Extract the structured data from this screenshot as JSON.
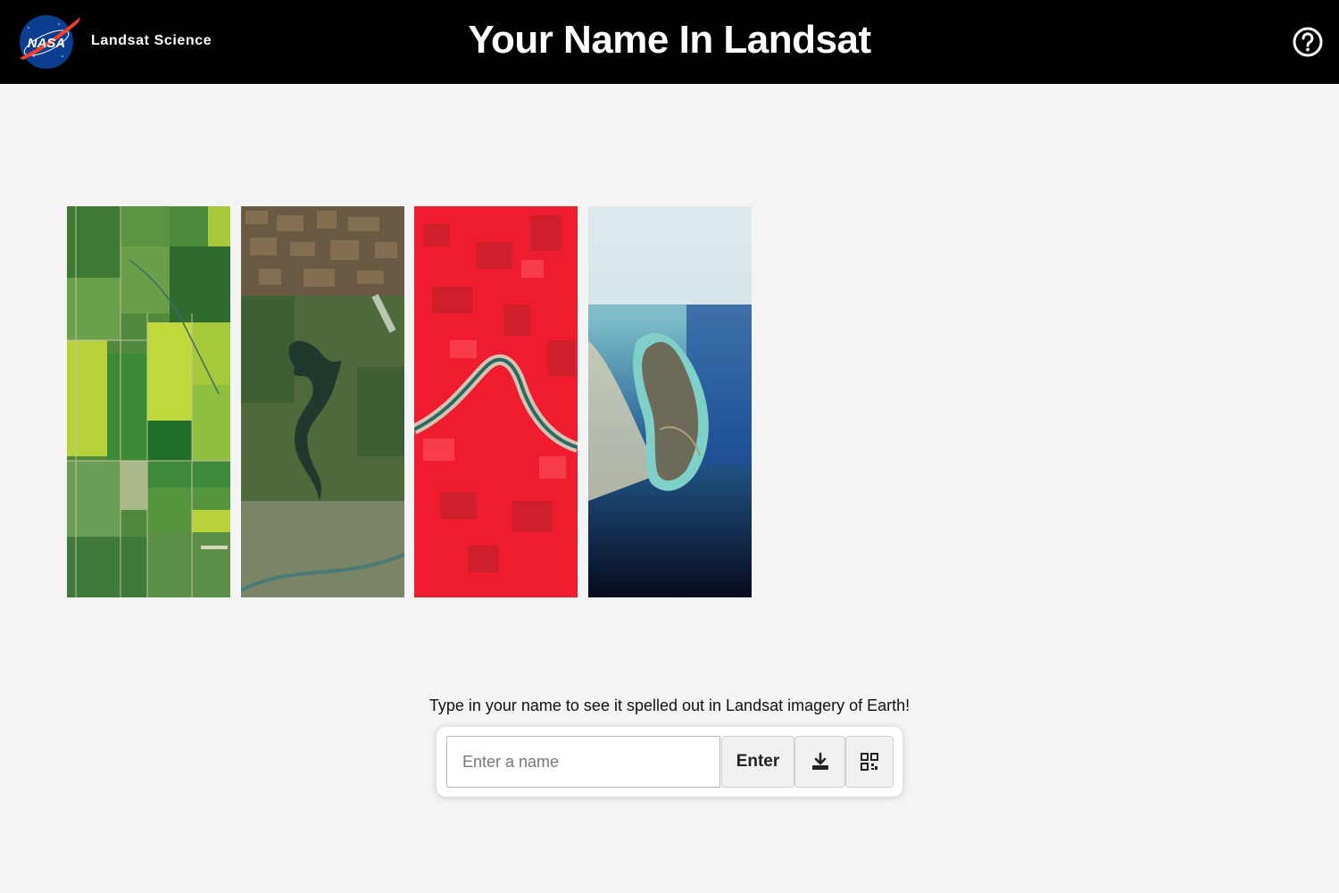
{
  "header": {
    "logo_text": "NASA",
    "brand": "Landsat Science",
    "title": "Your Name In Landsat",
    "help_icon": "question-circle-icon"
  },
  "tiles": [
    {
      "name": "letter-tile-1",
      "scene": "green-agricultural-fields"
    },
    {
      "name": "letter-tile-2",
      "scene": "oxbow-lake-farmland"
    },
    {
      "name": "letter-tile-3",
      "scene": "false-color-red-river"
    },
    {
      "name": "letter-tile-4",
      "scene": "island-in-turquoise-sea"
    }
  ],
  "prompt": "Type in your name to see it spelled out in Landsat imagery of Earth!",
  "form": {
    "placeholder": "Enter a name",
    "value": "",
    "enter_label": "Enter",
    "download_icon": "download-icon",
    "qr_icon": "qr-code-icon"
  },
  "colors": {
    "header_bg": "#000000",
    "page_bg": "#f4f4f4",
    "nasa_blue": "#0b3d91",
    "nasa_red": "#fc3d21"
  }
}
